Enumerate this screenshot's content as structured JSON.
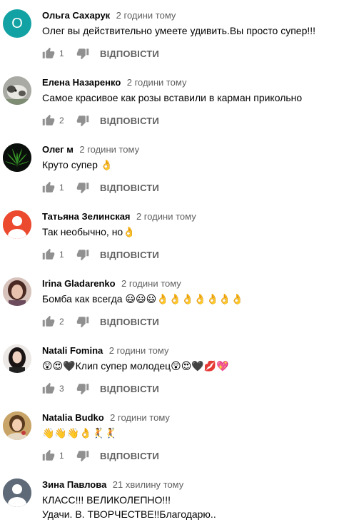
{
  "comments": [
    {
      "author": "Ольга Сахарук",
      "time": "2 години тому",
      "text": "Олег вы действительно умеете удивить.Вы просто супер!!!",
      "likes": "1",
      "avatar_letter": "О",
      "avatar_color": "#13a2a4",
      "avatar_icon": "letter-avatar"
    },
    {
      "author": "Елена Назаренко",
      "time": "2 години тому",
      "text": "Самое красивое как розы вставили в карман прикольно",
      "likes": "2",
      "avatar_icon": "dog-photo-avatar"
    },
    {
      "author": "Олег м",
      "time": "2 години тому",
      "text": "Круто супер 👌",
      "likes": "1",
      "avatar_icon": "cannabis-leaf-avatar"
    },
    {
      "author": "Татьяна Зелинская",
      "time": "2 години тому",
      "text": "Так необычно, но👌",
      "likes": "1",
      "avatar_icon": "default-person-avatar",
      "avatar_color": "#ec4a2f"
    },
    {
      "author": "Irina Gladarenko",
      "time": "2 години тому",
      "text": "Бомба как всегда 😃😃😃👌👌👌👌👌👌👌",
      "likes": "2",
      "avatar_icon": "woman-photo-avatar"
    },
    {
      "author": "Natali Fomina",
      "time": "2 години тому",
      "text": "😲😍🖤Клип супер молодец😲😍🖤💋💖",
      "likes": "3",
      "avatar_icon": "woman-photo-avatar"
    },
    {
      "author": "Natalia Budko",
      "time": "2 години тому",
      "text": "👋👋👋👌🤾🤾",
      "likes": "1",
      "avatar_icon": "painting-avatar"
    },
    {
      "author": "Зина Павлова",
      "time": "21 хвилину тому",
      "text": "КЛАСС!!! ВЕЛИКОЛЕПНО!!!\nУдачи. В. ТВОРЧЕСТВЕ!!Благодарю..",
      "avatar_icon": "default-person-avatar",
      "avatar_color": "#5f6a78"
    }
  ],
  "reply_label": "ВІДПОВІСТИ",
  "colors": {
    "text": "#030303",
    "secondary": "#606060",
    "icon": "#909090"
  }
}
